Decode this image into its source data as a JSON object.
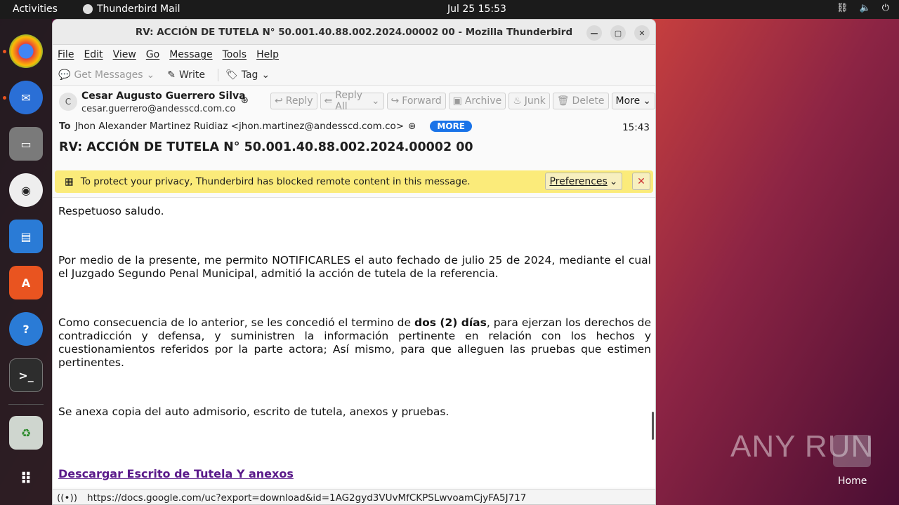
{
  "topbar": {
    "activities": "Activities",
    "app": "Thunderbird Mail",
    "clock": "Jul 25  15:53"
  },
  "window": {
    "title": "RV: ACCIÓN DE TUTELA N° 50.001.40.88.002.2024.00002 00 - Mozilla Thunderbird"
  },
  "menu": [
    "File",
    "Edit",
    "View",
    "Go",
    "Message",
    "Tools",
    "Help"
  ],
  "toolbar": {
    "get_messages": "Get Messages",
    "write": "Write",
    "tag": "Tag"
  },
  "message": {
    "avatar_letter": "C",
    "sender_name": "Cesar Augusto Guerrero Silva",
    "sender_email": "cesar.guerrero@andesscd.com.co",
    "buttons": {
      "reply": "Reply",
      "reply_all": "Reply All",
      "forward": "Forward",
      "archive": "Archive",
      "junk": "Junk",
      "delete": "Delete",
      "more": "More"
    },
    "to_label": "To",
    "to_value": "Jhon Alexander Martinez Ruidiaz <jhon.martinez@andesscd.com.co>",
    "more_pill": "MORE",
    "time": "15:43",
    "subject": "RV: ACCIÓN DE TUTELA N° 50.001.40.88.002.2024.00002 00"
  },
  "notice": {
    "text": "To protect your privacy, Thunderbird has blocked remote content in this message.",
    "preferences": "Preferences"
  },
  "body": {
    "p1": "Respetuoso saludo.",
    "p2": "Por medio de la presente, me permito NOTIFICARLES el auto fechado de julio 25 de 2024, mediante el cual el Juzgado Segundo Penal Municipal, admitió la acción de tutela de la referencia.",
    "p3_before": "Como consecuencia de lo anterior, se les concedió el termino de ",
    "p3_bold": "dos (2) días",
    "p3_after": ", para ejerzan los derechos de contradicción y defensa, y suministren la información pertinente en relación con los hechos y cuestionamientos referidos por la parte actora; Así mismo, para que alleguen las pruebas que estimen pertinentes.",
    "p4": "Se anexa copia del auto admisorio, escrito de tutela, anexos y pruebas.",
    "link": "Descargar Escrito de Tutela Y anexos"
  },
  "status": {
    "url": "https://docs.google.com/uc?export=download&id=1AG2gyd3VUvMfCKPSLwvoamCjyFA5J717"
  },
  "desktop": {
    "watermark": "ANY RUN",
    "home_label": "Home"
  }
}
